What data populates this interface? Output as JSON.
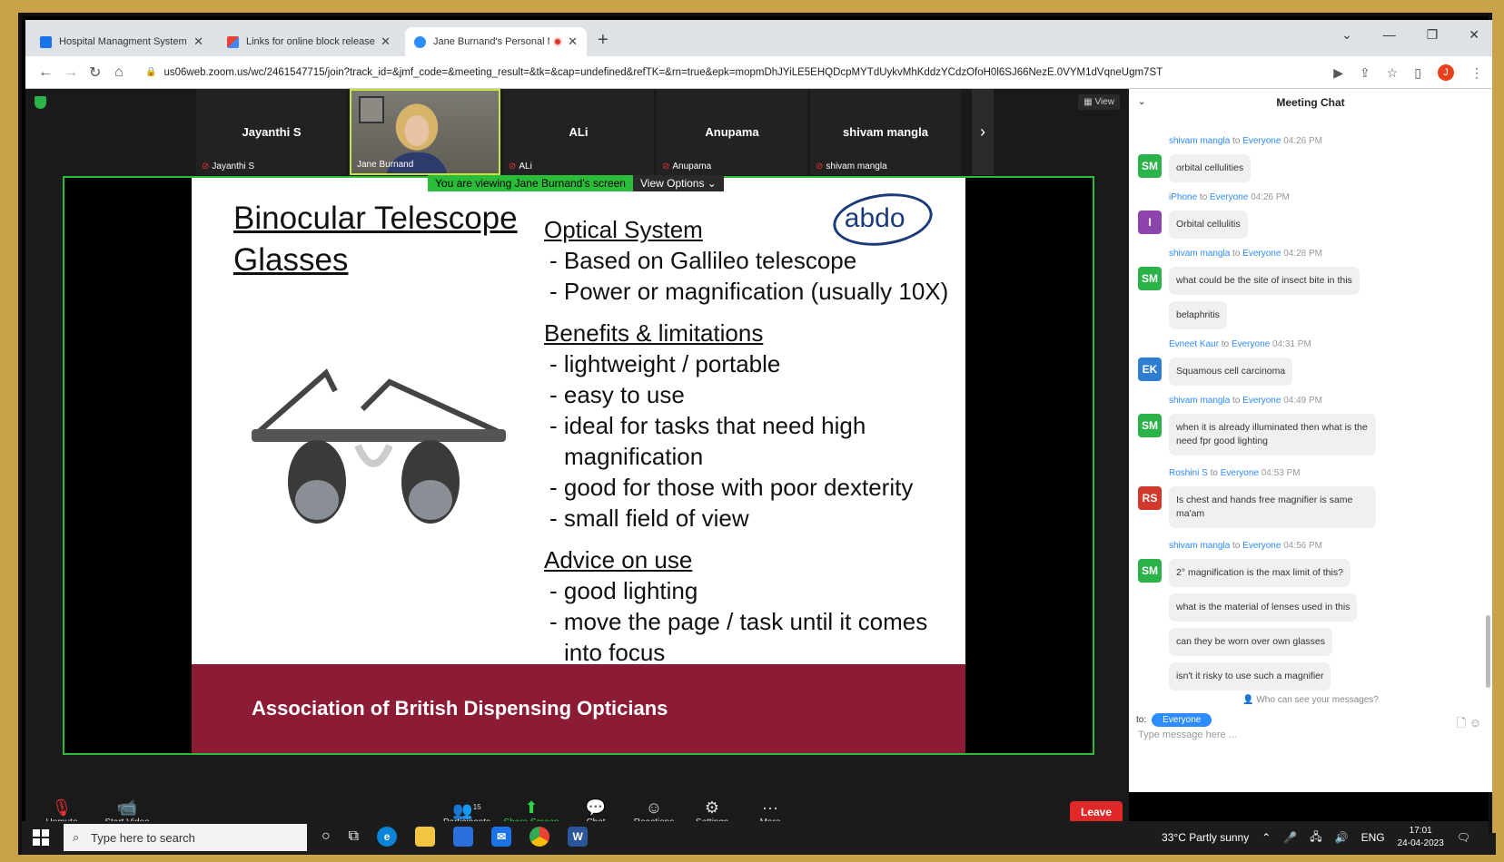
{
  "browser": {
    "tabs": [
      {
        "title": "Hospital Managment System",
        "icon_color": "#1a73e8"
      },
      {
        "title": "Links for online block release - ai",
        "icon_color": "#ea4335"
      },
      {
        "title": "Jane Burnand's Personal Mee",
        "icon_color": "#2d8cff"
      }
    ],
    "url": "us06web.zoom.us/wc/2461547715/join?track_id=&jmf_code=&meeting_result=&tk=&cap=undefined&refTK=&rn=true&epk=mopmDhJYiLE5EHQDcpMYTdUykvMhKddzYCdzOfoH0l6SJ66NezE.0VYM1dVqneUgm7ST",
    "profile_initial": "J"
  },
  "zoom": {
    "view_label": "View",
    "participants": [
      {
        "name": "Jayanthi S",
        "label": "Jayanthi S",
        "video": false
      },
      {
        "name": "Jane Burnand",
        "label": "Jane Burnand",
        "video": true
      },
      {
        "name": "ALi",
        "label": "ALi",
        "video": false
      },
      {
        "name": "Anupama",
        "label": "Anupama",
        "video": false
      },
      {
        "name": "shivam mangla",
        "label": "shivam mangla",
        "video": false
      }
    ],
    "share_banner": "You are viewing Jane Burnand's screen",
    "view_options": "View Options",
    "controls": {
      "unmute": "Unmute",
      "start_video": "Start Video",
      "participants": "Participants",
      "participant_count": "15",
      "share_screen": "Share Screen",
      "chat": "Chat",
      "reactions": "Reactions",
      "settings": "Settings",
      "more": "More",
      "leave": "Leave"
    }
  },
  "slide": {
    "title_line1": "Binocular Telescope",
    "title_line2": "Glasses",
    "logo": "abdo",
    "section1": "Optical System",
    "s1_items": [
      "- Based on Gallileo telescope",
      "- Power or magnification (usually 10X)"
    ],
    "section2": "Benefits & limitations",
    "s2_items": [
      "- lightweight / portable",
      "- easy to use",
      "- ideal for tasks that need high"
    ],
    "s2_cont": "magnification",
    "s2_items_b": [
      "- good for those with poor dexterity",
      "- small field of view"
    ],
    "section3": "Advice on use",
    "s3_items": [
      "- good lighting",
      "- move the page / task until it comes"
    ],
    "s3_cont": "into focus",
    "footer": "Association of British Dispensing Opticians"
  },
  "chat": {
    "title": "Meeting Chat",
    "to_word": "to",
    "messages": [
      {
        "from": "shivam mangla",
        "to": "Everyone",
        "time": "04:26 PM",
        "initials": "SM",
        "color": "#2bb34a",
        "bubbles": [
          "orbital cellulities"
        ]
      },
      {
        "from": "iPhone",
        "to": "Everyone",
        "time": "04:26 PM",
        "initials": "I",
        "color": "#8e44ad",
        "bubbles": [
          "Orbital cellulitis"
        ]
      },
      {
        "from": "shivam mangla",
        "to": "Everyone",
        "time": "04:28 PM",
        "initials": "SM",
        "color": "#2bb34a",
        "bubbles": [
          "what could be the site of insect bite in this",
          "belaphritis"
        ]
      },
      {
        "from": "Evneet Kaur",
        "to": "Everyone",
        "time": "04:31 PM",
        "initials": "EK",
        "color": "#2e7dd1",
        "bubbles": [
          "Squamous cell carcinoma"
        ]
      },
      {
        "from": "shivam mangla",
        "to": "Everyone",
        "time": "04:49 PM",
        "initials": "SM",
        "color": "#2bb34a",
        "bubbles": [
          "when it is already illuminated then  what is the need fpr good lighting"
        ]
      },
      {
        "from": "Roshini S",
        "to": "Everyone",
        "time": "04:53 PM",
        "initials": "RS",
        "color": "#d0392b",
        "bubbles": [
          "Is chest and hands free magnifier is same ma'am"
        ]
      },
      {
        "from": "shivam mangla",
        "to": "Everyone",
        "time": "04:56 PM",
        "initials": "SM",
        "color": "#2bb34a",
        "bubbles": [
          "2° magnification is the max limit of this?",
          "what is the material of lenses used in this",
          "can they be worn over own glasses",
          "isn't it risky to use such a magnifier"
        ]
      }
    ],
    "who_can_see": "Who can see your messages?",
    "to_label": "to:",
    "recipient": "Everyone",
    "placeholder": "Type message here ..."
  },
  "taskbar": {
    "search_placeholder": "Type here to search",
    "weather": "33°C  Partly sunny",
    "lang": "ENG",
    "time": "17:01",
    "date": "24-04-2023"
  }
}
